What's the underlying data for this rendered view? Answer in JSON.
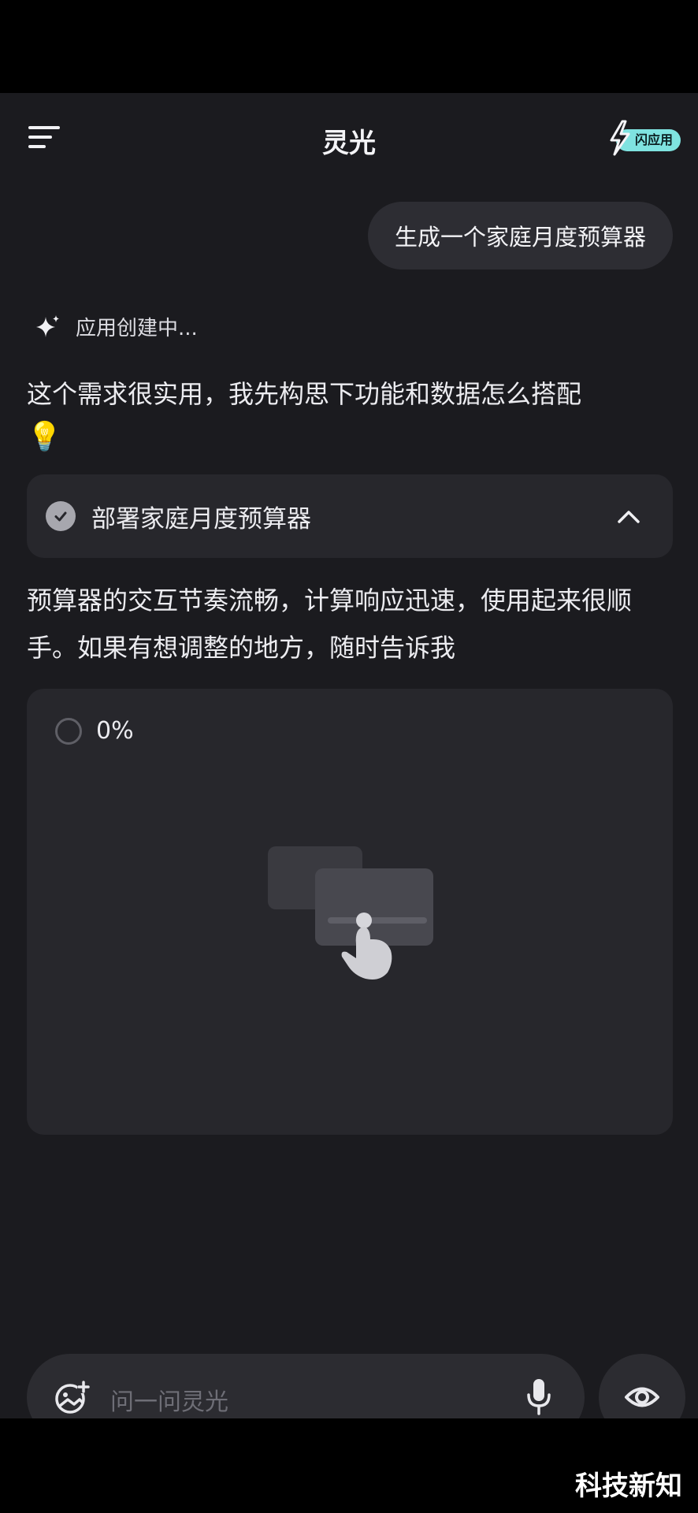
{
  "header": {
    "title": "灵光",
    "badge": "闪应用"
  },
  "chat": {
    "user_message": "生成一个家庭月度预算器",
    "status": "应用创建中...",
    "reply1": "这个需求很实用，我先构思下功能和数据怎么搭配",
    "reply1_emoji": "💡",
    "deploy_step": {
      "label": "部署家庭月度预算器",
      "done": true,
      "expanded": true
    },
    "reply2": "预算器的交互节奏流畅，计算响应迅速，使用起来很顺手。如果有想调整的地方，随时告诉我",
    "preview": {
      "progress": "0%"
    }
  },
  "input": {
    "placeholder": "问一问灵光"
  },
  "watermark": "科技新知",
  "colors": {
    "background": "#1b1b1f",
    "card": "#27272c",
    "accent": "#7fe3e0"
  }
}
